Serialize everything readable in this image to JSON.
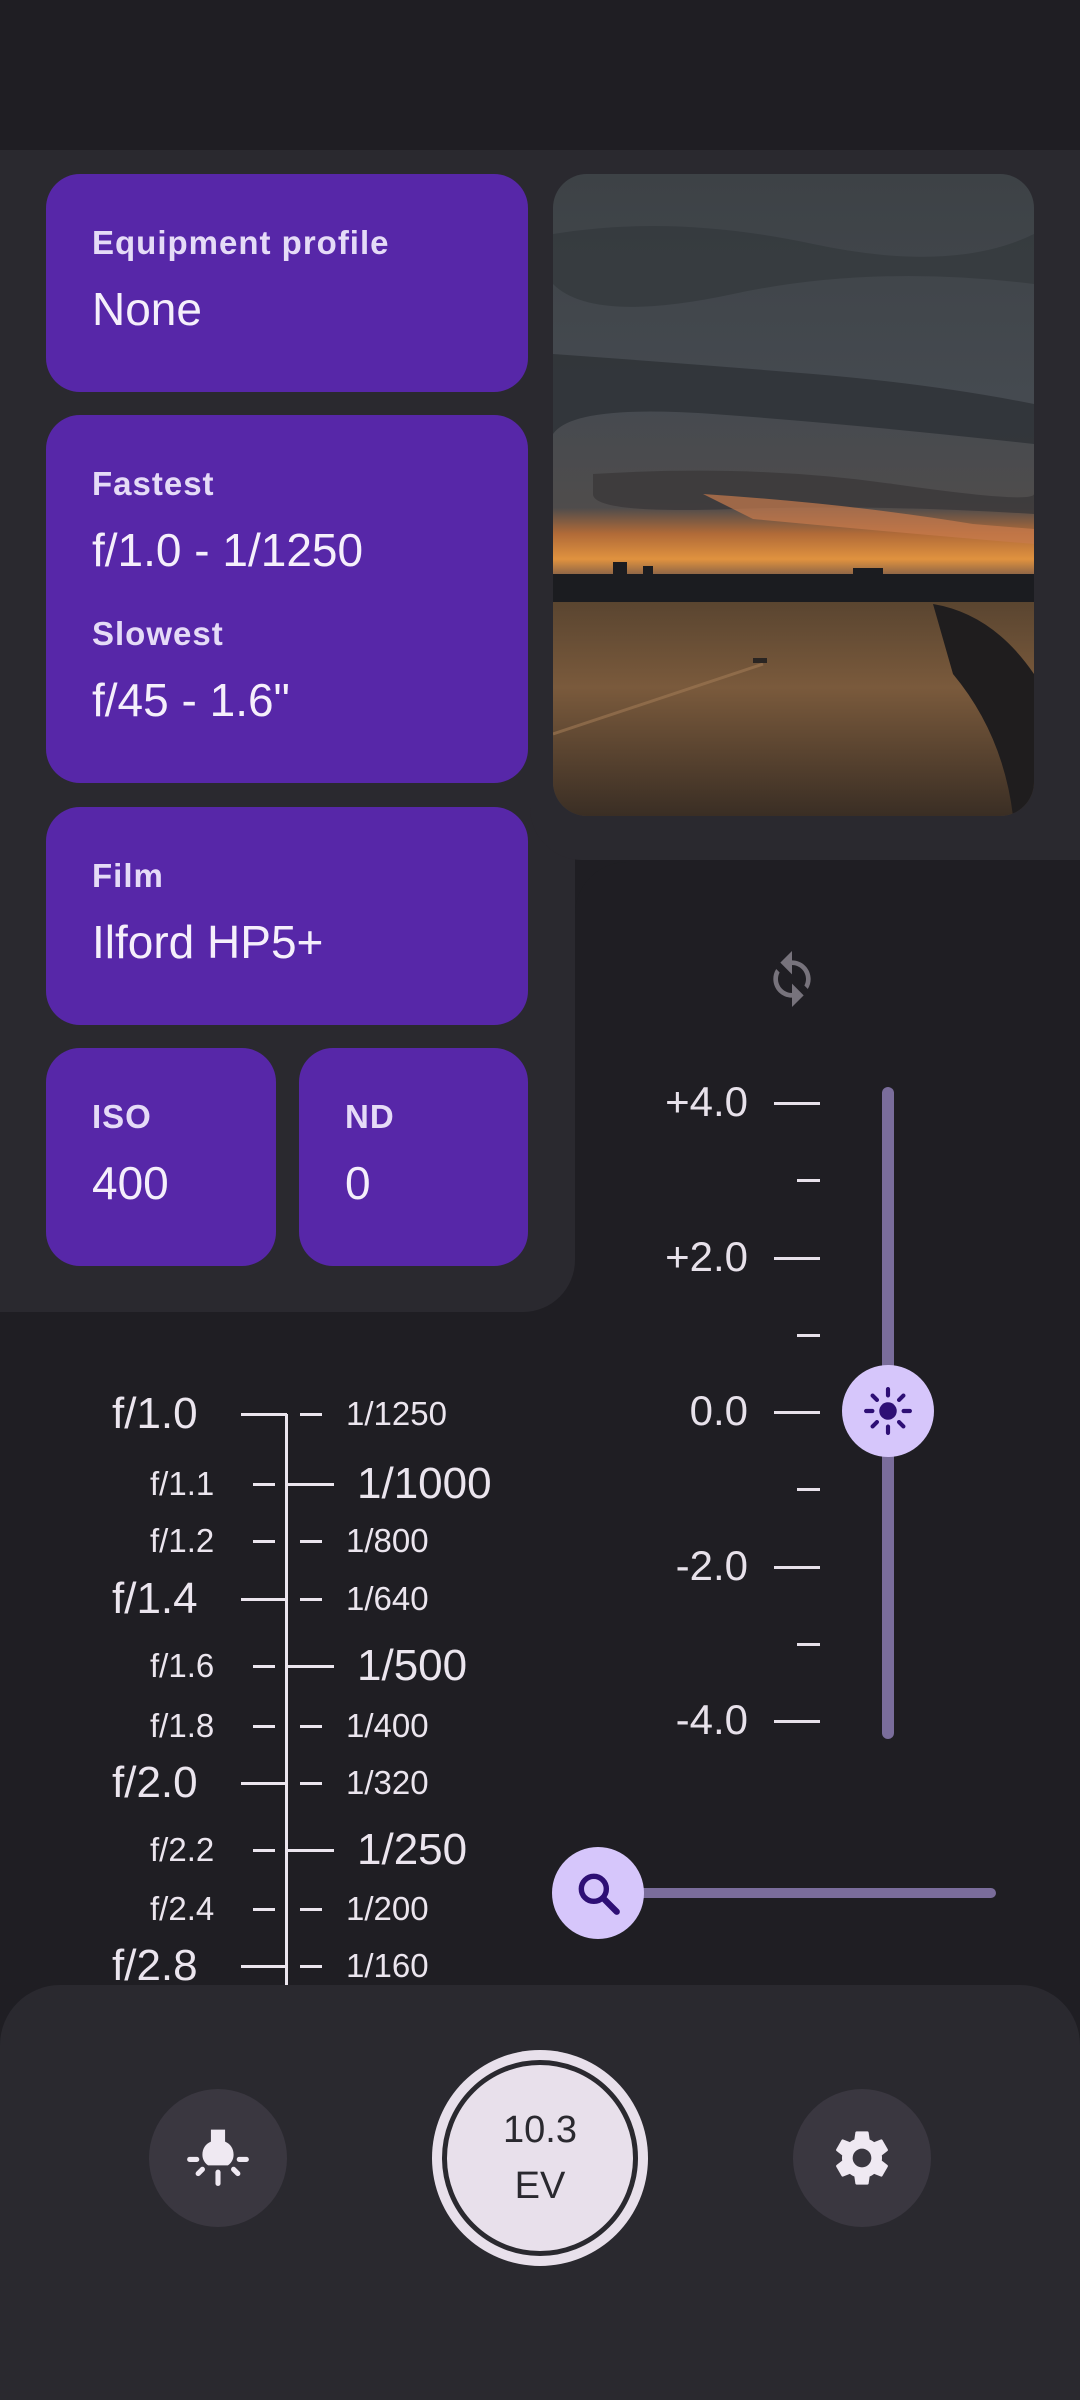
{
  "cards": {
    "equipment": {
      "label": "Equipment profile",
      "value": "None"
    },
    "fastest": {
      "label": "Fastest",
      "value": "f/1.0 - 1/1250"
    },
    "slowest": {
      "label": "Slowest",
      "value": "f/45 - 1.6\""
    },
    "film": {
      "label": "Film",
      "value": "Ilford HP5+"
    },
    "iso": {
      "label": "ISO",
      "value": "400"
    },
    "nd": {
      "label": "ND",
      "value": "0"
    }
  },
  "photo": {
    "description": "sunset-over-river-preview"
  },
  "ev_scale": {
    "labels": [
      "+4.0",
      "+2.0",
      "0.0",
      "-2.0",
      "-4.0"
    ],
    "range": [
      -4.0,
      4.0
    ],
    "value": 0.0
  },
  "zoom": {
    "value": 0.0
  },
  "scale": {
    "apertures": [
      {
        "text": "f/1.0",
        "major": true
      },
      {
        "text": "f/1.1",
        "major": false
      },
      {
        "text": "f/1.2",
        "major": false
      },
      {
        "text": "f/1.4",
        "major": true
      },
      {
        "text": "f/1.6",
        "major": false
      },
      {
        "text": "f/1.8",
        "major": false
      },
      {
        "text": "f/2.0",
        "major": true
      },
      {
        "text": "f/2.2",
        "major": false
      },
      {
        "text": "f/2.4",
        "major": false
      },
      {
        "text": "f/2.8",
        "major": true
      }
    ],
    "shutters": [
      {
        "text": "1/1250",
        "major": false
      },
      {
        "text": "1/1000",
        "major": true
      },
      {
        "text": "1/800",
        "major": false
      },
      {
        "text": "1/640",
        "major": false
      },
      {
        "text": "1/500",
        "major": true
      },
      {
        "text": "1/400",
        "major": false
      },
      {
        "text": "1/320",
        "major": false
      },
      {
        "text": "1/250",
        "major": true
      },
      {
        "text": "1/200",
        "major": false
      },
      {
        "text": "1/160",
        "major": false
      }
    ]
  },
  "bottom": {
    "ev_value": "10.3",
    "ev_unit": "EV",
    "left_icon": "light-bulb-icon",
    "right_icon": "gear-icon"
  },
  "colors": {
    "background": "#1f1e23",
    "surface": "#2a292f",
    "card": "#5727a8",
    "accent": "#d6c6fb"
  }
}
